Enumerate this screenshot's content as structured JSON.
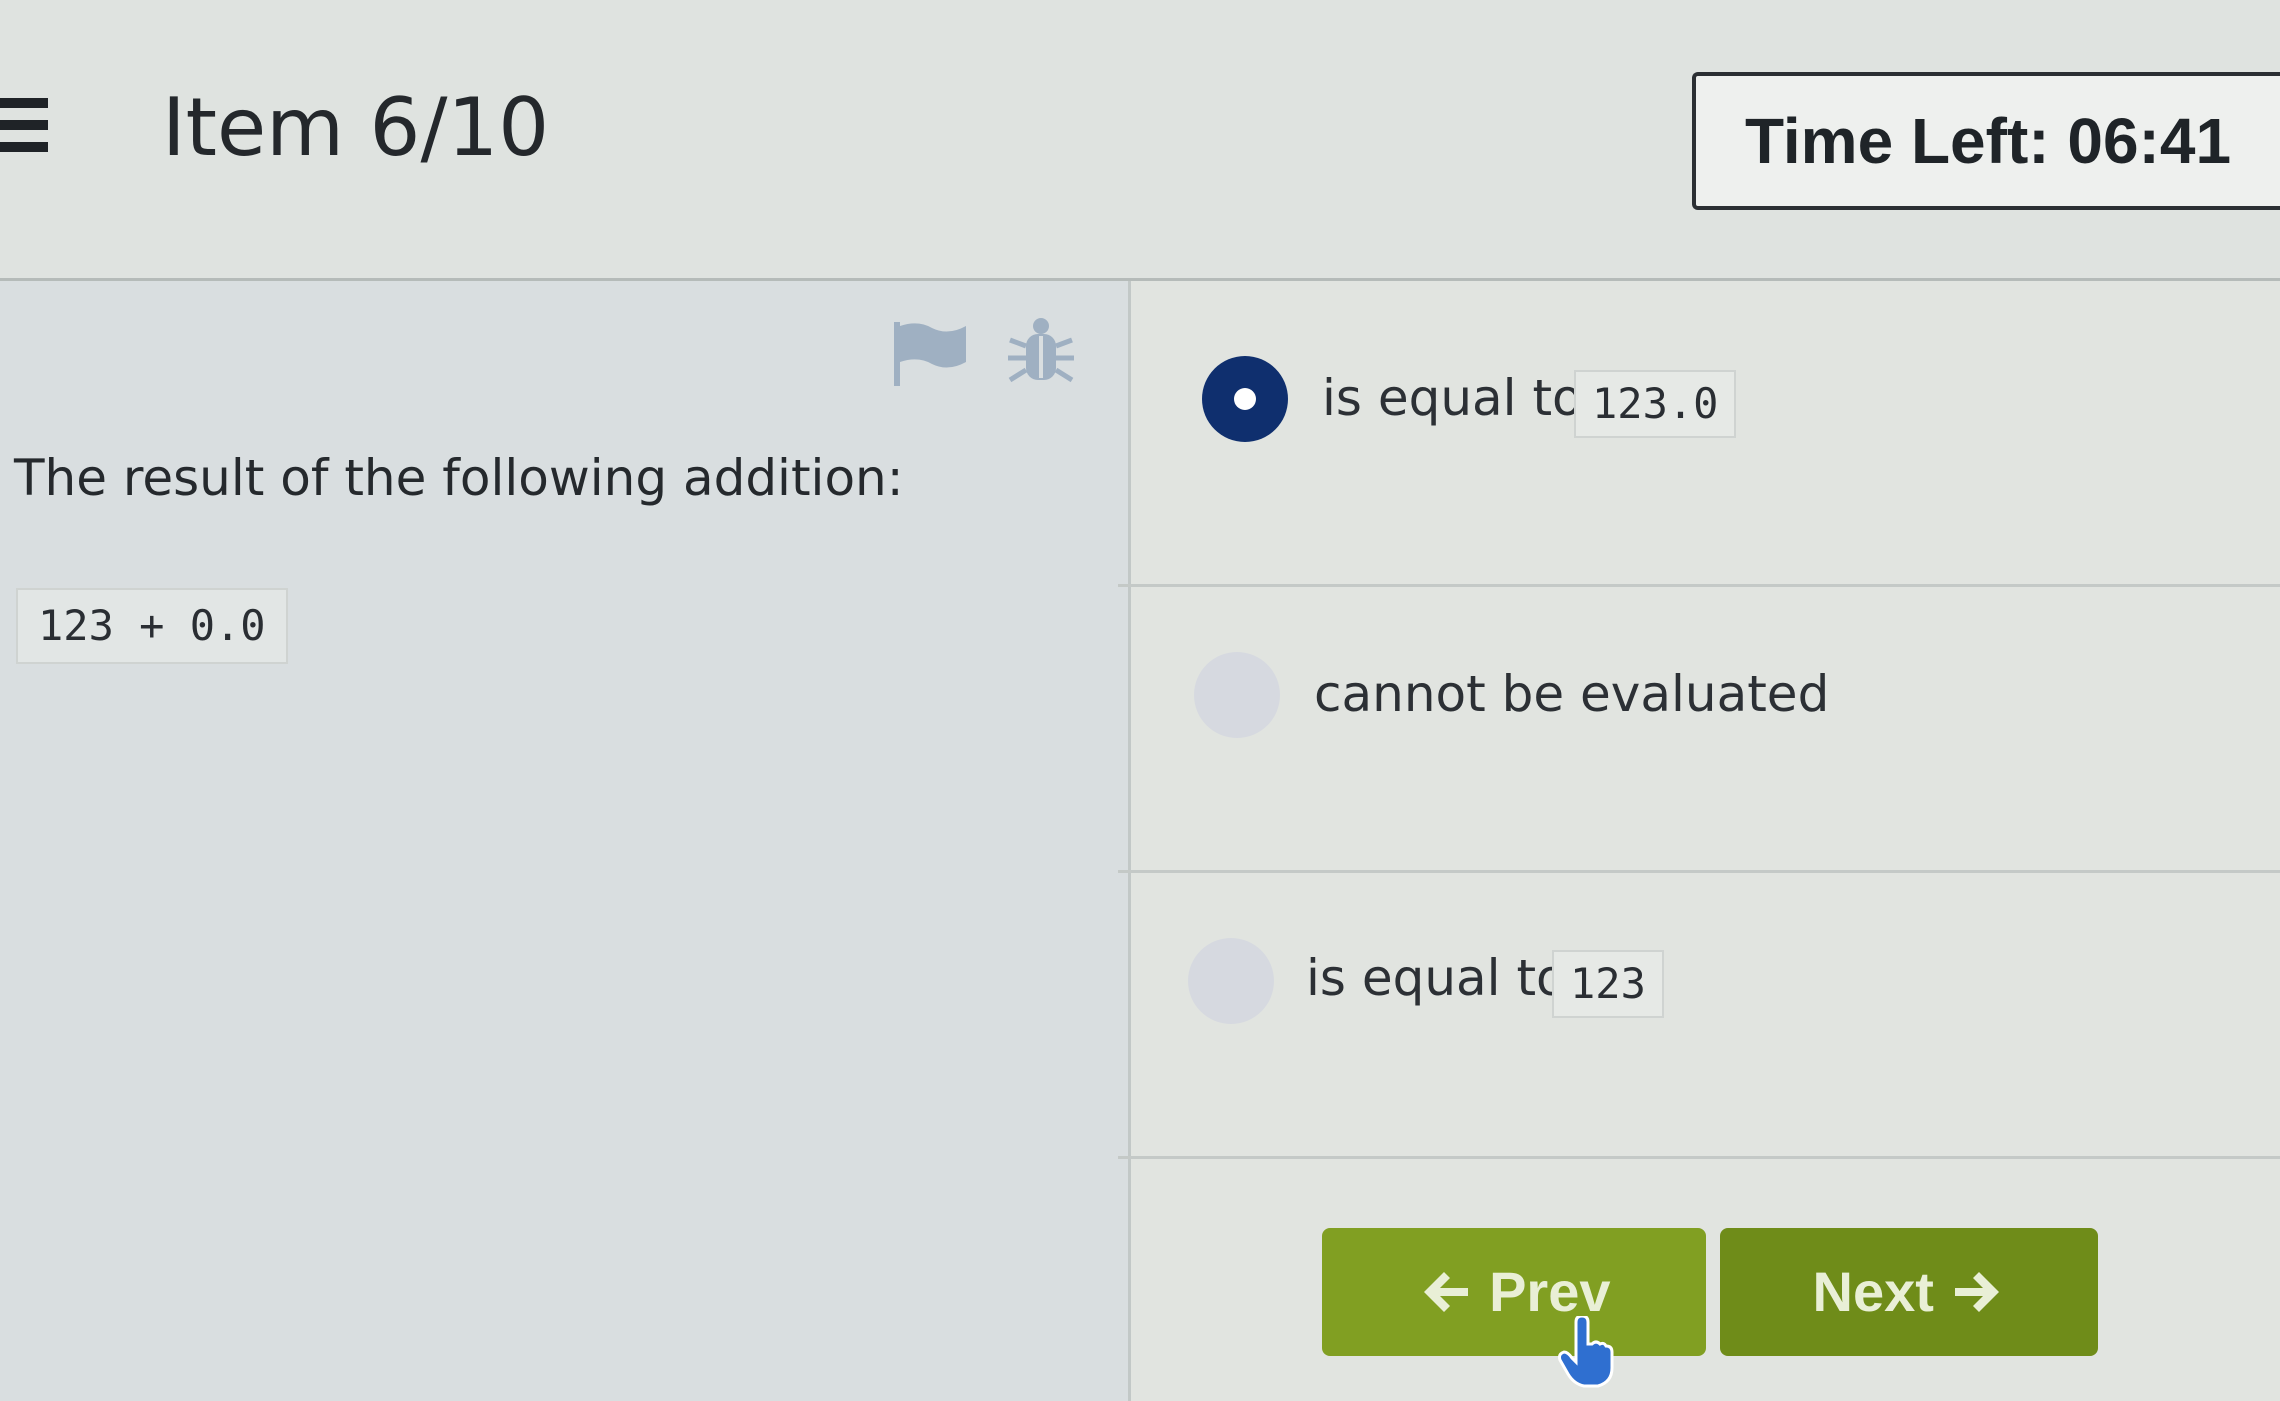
{
  "header": {
    "item_label": "Item 6/10",
    "timer_label": "Time Left: 06:41"
  },
  "question": {
    "prompt": "The result of the following addition:",
    "code": "123 + 0.0",
    "icons": [
      "flag-icon",
      "bug-icon"
    ]
  },
  "options": [
    {
      "text": "is equal to",
      "code": "123.0",
      "selected": true
    },
    {
      "text": "cannot be evaluated",
      "code": "",
      "selected": false
    },
    {
      "text": "is equal to",
      "code": "123",
      "selected": false
    }
  ],
  "navigation": {
    "prev_label": "Prev",
    "next_label": "Next"
  },
  "colors": {
    "selected_radio": "#0f2f6e",
    "button_green": "#7c9a1e"
  }
}
